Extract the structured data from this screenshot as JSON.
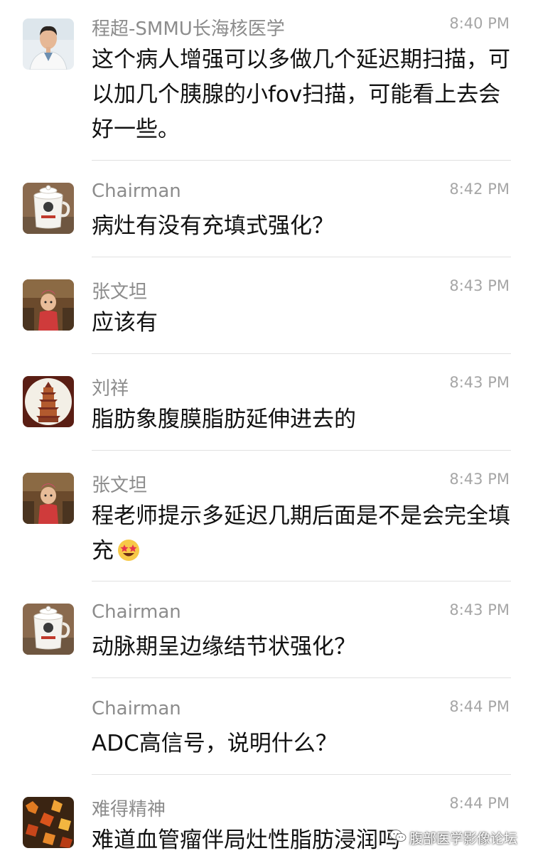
{
  "messages": [
    {
      "sender": "程超-SMMU长海核医学",
      "time": "8:40 PM",
      "text": "这个病人增强可以多做几个延迟期扫描，可以加几个胰腺的小fov扫描，可能看上去会好一些。",
      "avatar": "doctor-avatar"
    },
    {
      "sender": "Chairman",
      "time": "8:42 PM",
      "text": "病灶有没有充填式强化？",
      "avatar": "mug-avatar"
    },
    {
      "sender": "张文坦",
      "time": "8:43 PM",
      "text": "应该有",
      "avatar": "child-avatar"
    },
    {
      "sender": "刘祥",
      "time": "8:43 PM",
      "text": "脂肪象腹膜脂肪延伸进去的",
      "avatar": "pagoda-avatar"
    },
    {
      "sender": "张文坦",
      "time": "8:43 PM",
      "text": "程老师提示多延迟几期后面是不是会完全填充",
      "emoji": "star-struck-emoji",
      "avatar": "child-avatar"
    },
    {
      "sender": "Chairman",
      "time": "8:43 PM",
      "text": "动脉期呈边缘结节状强化？",
      "avatar": "mug-avatar"
    },
    {
      "sender": "Chairman",
      "time": "8:44 PM",
      "text": "ADC高信号，说明什么？",
      "avatar": "none"
    },
    {
      "sender": "难得精神",
      "time": "8:44 PM",
      "text": "难道血管瘤伴局灶性脂肪浸润吗",
      "avatar": "autumn-leaves-avatar"
    }
  ],
  "watermark": {
    "text": "腹部医学影像论坛",
    "icon": "wechat-icon"
  }
}
